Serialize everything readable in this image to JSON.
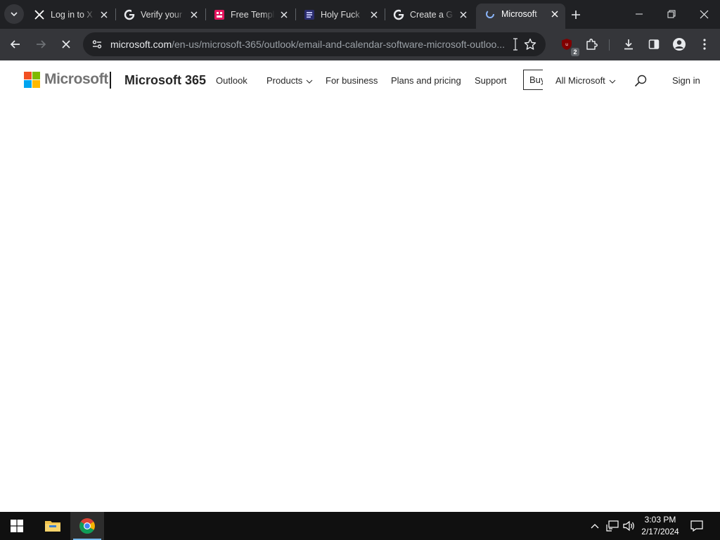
{
  "browser": {
    "tabs": [
      {
        "title": "Log in to X",
        "icon": "x-logo-icon",
        "active": false
      },
      {
        "title": "Verify your",
        "icon": "google-icon",
        "active": false
      },
      {
        "title": "Free Templ",
        "icon": "template-site-icon",
        "active": false
      },
      {
        "title": "Holy Fuck",
        "icon": "doc-site-icon",
        "active": false
      },
      {
        "title": "Create a G",
        "icon": "google-icon",
        "active": false
      },
      {
        "title": "Microsoft",
        "icon": "loading-icon",
        "active": true
      }
    ],
    "address": {
      "host": "microsoft.com",
      "path": "/en-us/microsoft-365/outlook/email-and-calendar-software-microsoft-outloo..."
    },
    "extension_badge": "2"
  },
  "site": {
    "logo_text": "Microsoft",
    "logo_colors": [
      "#f25022",
      "#7fba00",
      "#00a4ef",
      "#ffb900"
    ],
    "product_name": "Microsoft 365",
    "nav": {
      "outlook": "Outlook",
      "products": "Products",
      "for_business": "For business",
      "plans_pricing": "Plans and pricing",
      "support": "Support",
      "buy": "Buy now",
      "all_microsoft": "All Microsoft",
      "sign_in": "Sign in"
    }
  },
  "taskbar": {
    "time": "3:03 PM",
    "date": "2/17/2024",
    "accent": "#76b9ed"
  }
}
